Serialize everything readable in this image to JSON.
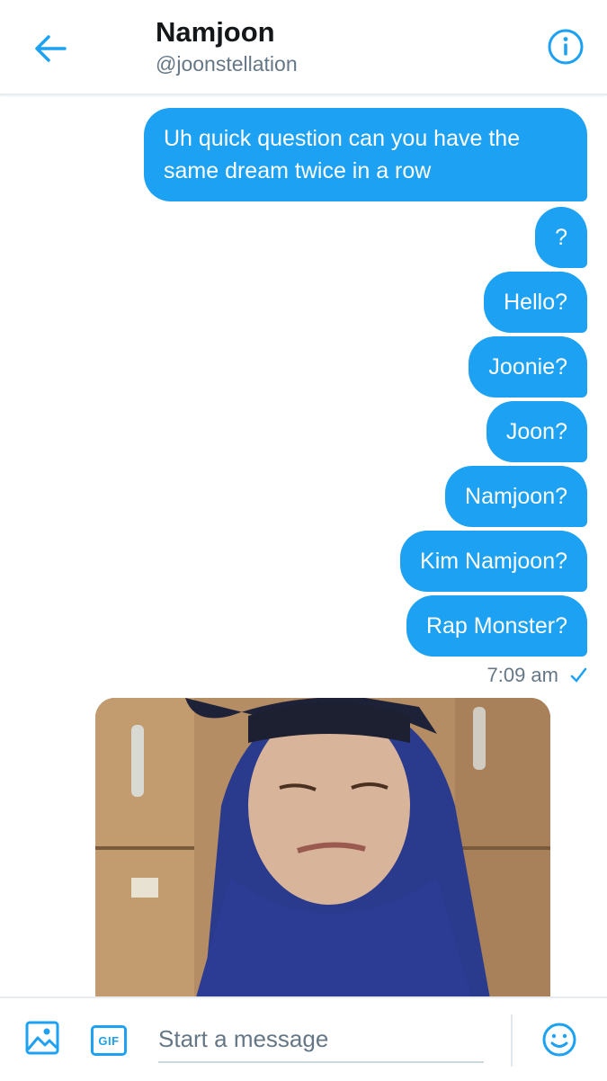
{
  "header": {
    "contact_name": "Namjoon",
    "contact_handle": "@joonstellation"
  },
  "messages": [
    {
      "text": "Uh quick question can you have the same dream twice in a row",
      "from": "me"
    },
    {
      "text": "?",
      "from": "me"
    },
    {
      "text": "Hello?",
      "from": "me"
    },
    {
      "text": "Joonie?",
      "from": "me"
    },
    {
      "text": "Joon?",
      "from": "me"
    },
    {
      "text": "Namjoon?",
      "from": "me"
    },
    {
      "text": "Kim Namjoon?",
      "from": "me"
    },
    {
      "text": "Rap Monster?",
      "from": "me"
    }
  ],
  "timestamp": "7:09 am",
  "composer": {
    "gif_label": "GIF",
    "placeholder": "Start a message"
  },
  "colors": {
    "accent": "#1da1f2",
    "secondary_text": "#657786"
  },
  "icons": [
    "back-arrow-icon",
    "info-icon",
    "sent-check-icon",
    "image-icon",
    "gif-icon",
    "emoji-icon"
  ]
}
